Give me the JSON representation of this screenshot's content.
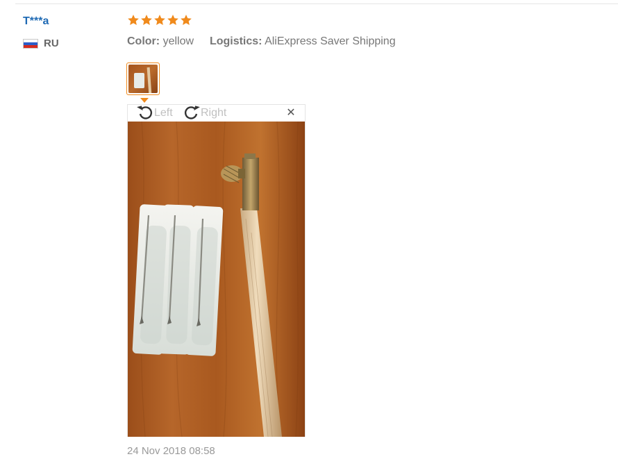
{
  "reviewer": {
    "name": "T***a",
    "country_code": "RU",
    "flag_icon": "russia-flag-icon"
  },
  "review": {
    "rating": 5,
    "rating_max": 5,
    "star_color": "#f08a1c",
    "color_label": "Color:",
    "color_value": "yellow",
    "logistics_label": "Logistics:",
    "logistics_value": "AliExpress Saver Shipping",
    "date": "24 Nov 2018 08:58"
  },
  "viewer": {
    "rotate_left_label": "Left",
    "rotate_right_label": "Right",
    "rotate_left_icon": "rotate-left-icon",
    "rotate_right_icon": "rotate-right-icon",
    "close_icon": "close-icon",
    "close_glyph": "✕",
    "accent_color": "#f08a1c"
  }
}
